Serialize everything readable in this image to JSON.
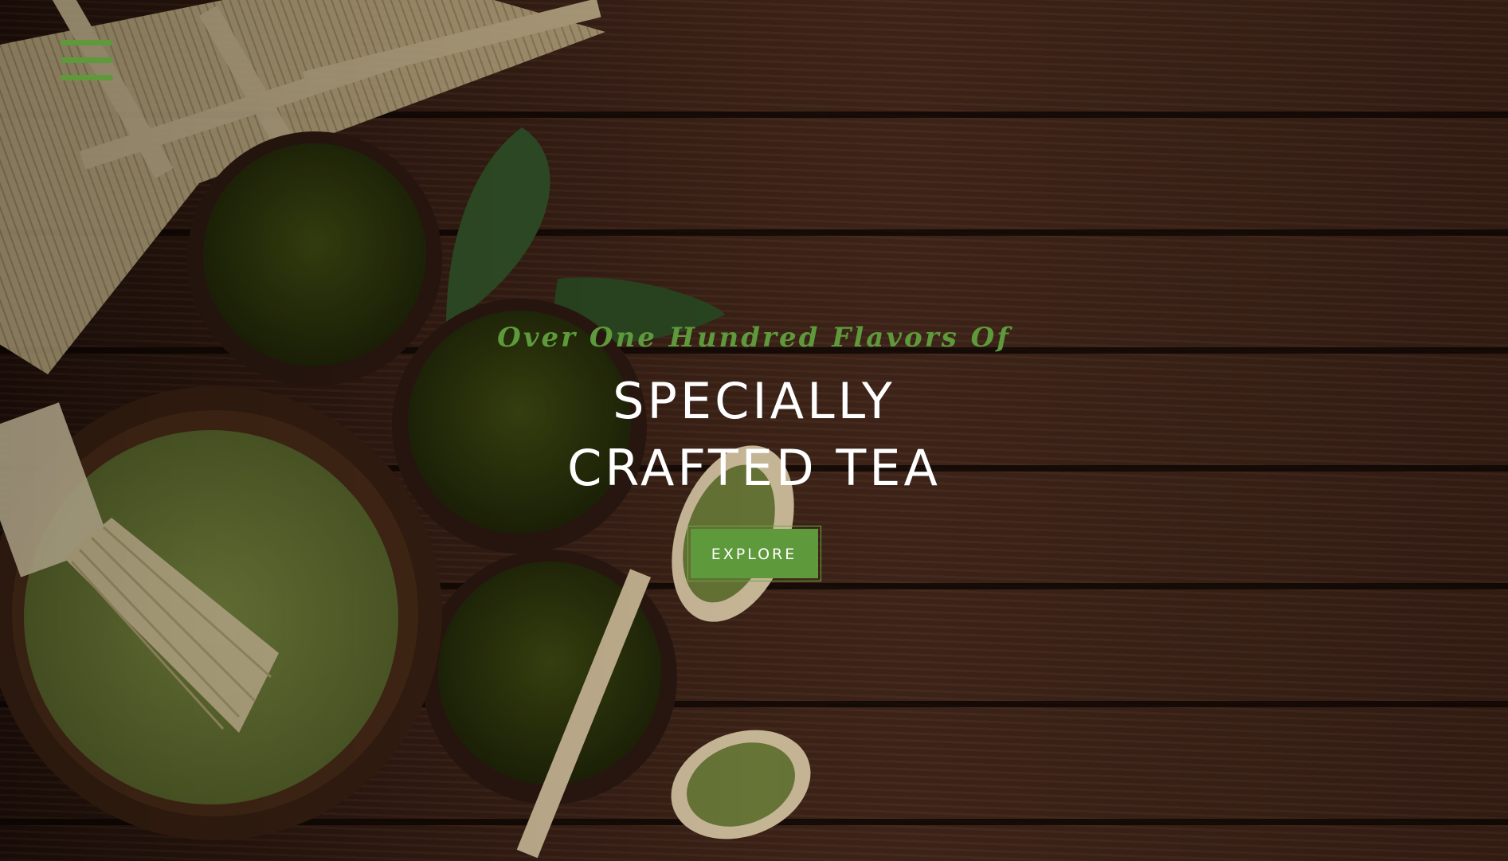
{
  "colors": {
    "accent": "#5e9a3c",
    "heading": "#ffffff",
    "background": "#3b2116"
  },
  "nav": {
    "menu_icon": "hamburger-icon"
  },
  "hero": {
    "background_image": "matcha-tea-on-wooden-table",
    "tagline": "Over One Hundred Flavors Of",
    "title_line_1": "SPECIALLY",
    "title_line_2": "CRAFTED TEA",
    "button_label": "EXPLORE"
  }
}
